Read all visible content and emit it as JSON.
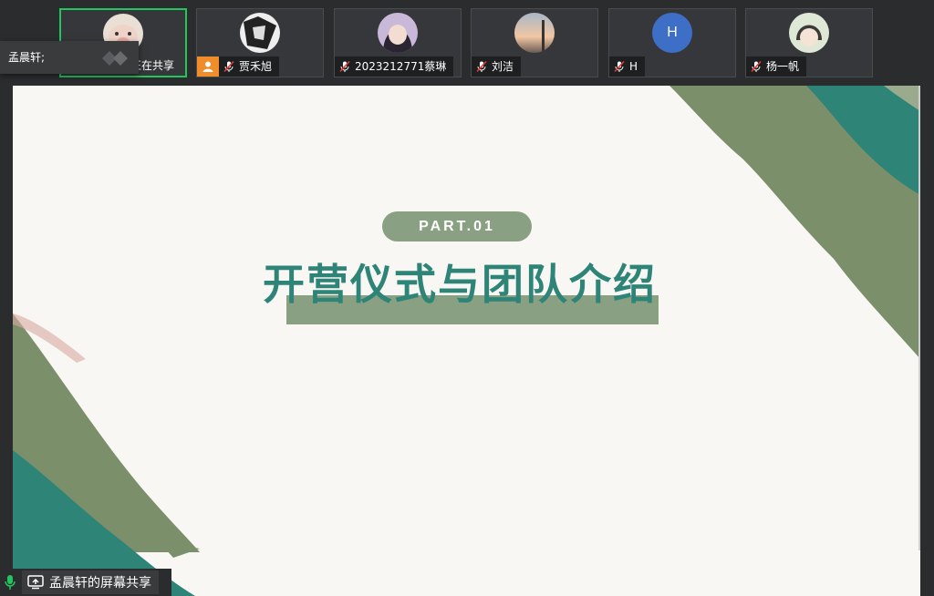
{
  "participants": [
    {
      "name": "孟晨轩正在共享",
      "avatar": "pig-photo",
      "active": true
    },
    {
      "name": "贾禾旭",
      "avatar": "manga-photo",
      "host": true
    },
    {
      "name": "2023212771蔡琳",
      "avatar": "anime-girl-photo"
    },
    {
      "name": "刘洁",
      "avatar": "sunset-photo"
    },
    {
      "name": "H",
      "avatar_letter": "H"
    },
    {
      "name": "杨一帆",
      "avatar": "anime-child-photo"
    }
  ],
  "tooltip": {
    "sharer": "孟晨轩;"
  },
  "slide": {
    "part_label": "PART.01",
    "title": "开营仪式与团队介绍",
    "colors": {
      "green": "#7a8f6a",
      "teal": "#2f8478",
      "pale": "#8aa083"
    }
  },
  "share_bar": {
    "label": "孟晨轩的屏幕共享"
  },
  "icons": {
    "mic_muted": "mic-muted-icon",
    "mic_active": "mic-active-icon",
    "screen_share": "screen-share-icon",
    "host": "host-icon"
  }
}
